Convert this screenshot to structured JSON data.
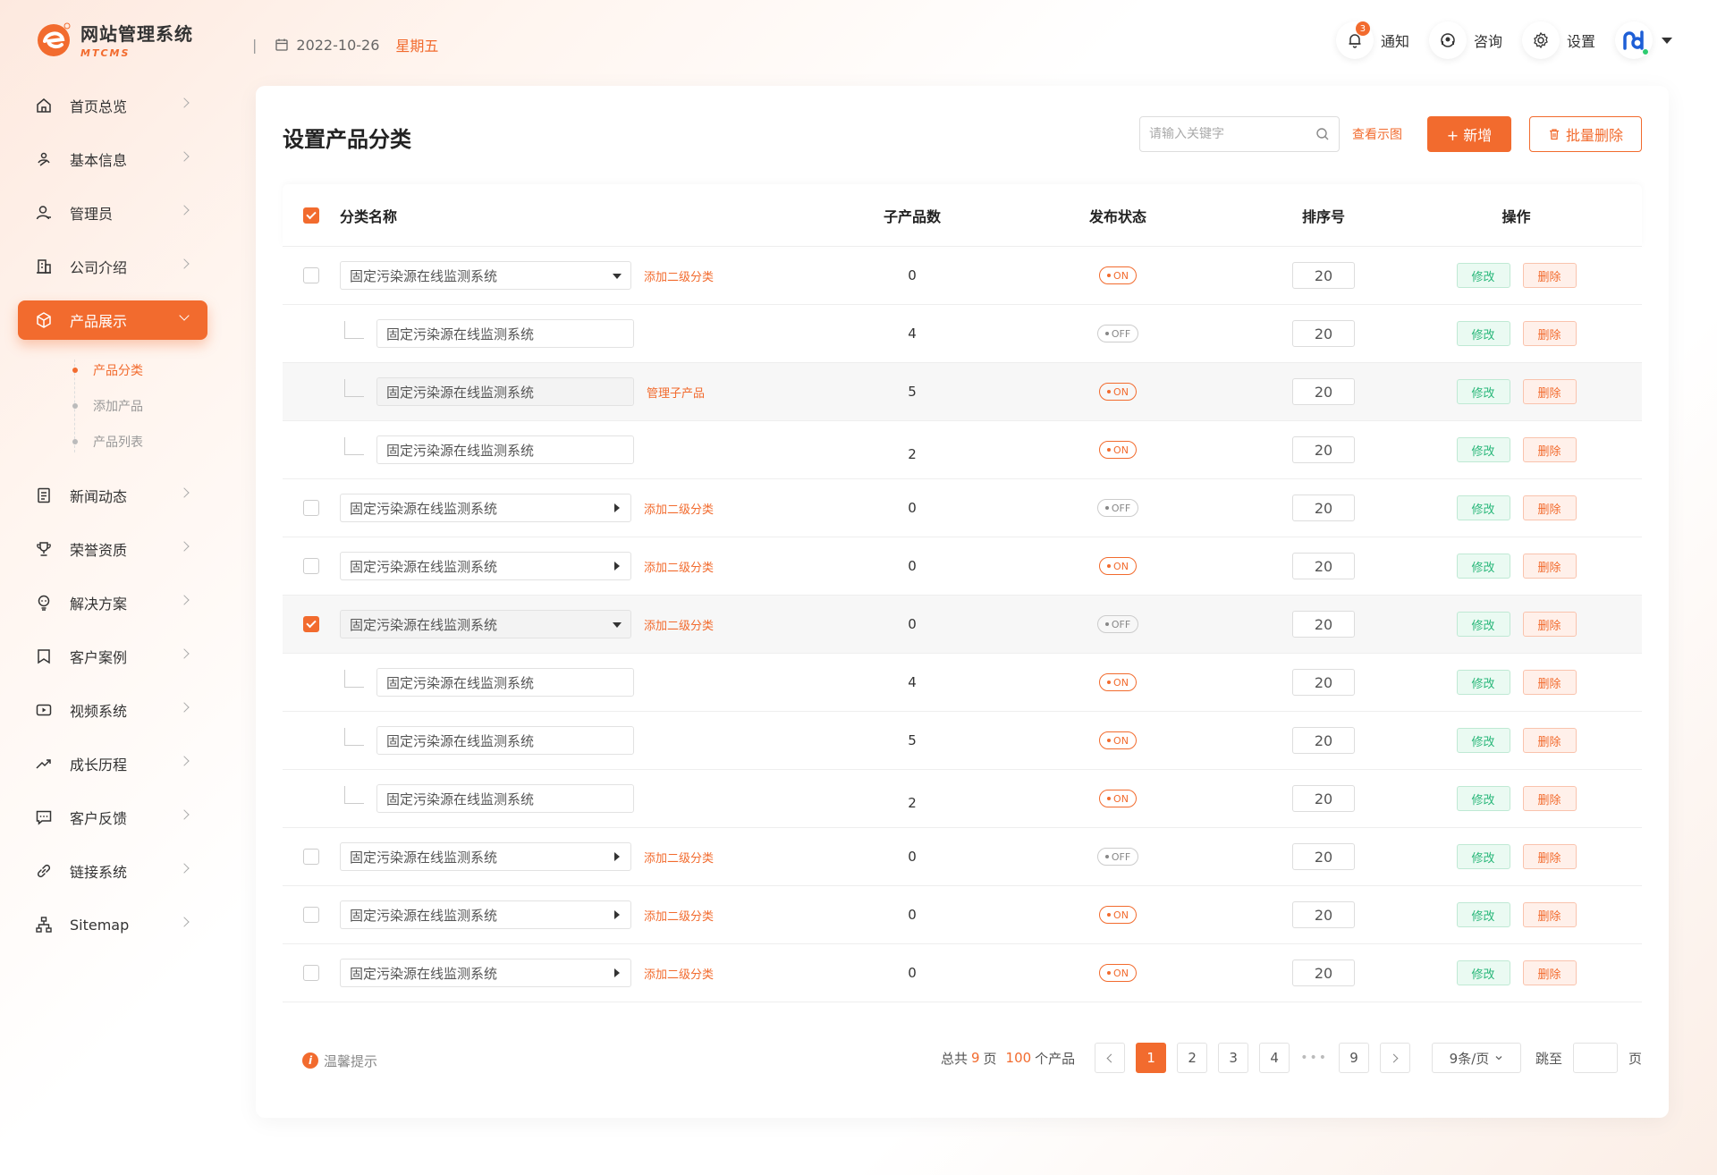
{
  "brand": {
    "title": "网站管理系统",
    "subtitle": "MTCMS"
  },
  "datebar": {
    "separator": "|",
    "date": "2022-10-26",
    "weekday": "星期五"
  },
  "topnav": {
    "notify": {
      "label": "通知",
      "badge": "3"
    },
    "consult": {
      "label": "咨询"
    },
    "settings": {
      "label": "设置"
    }
  },
  "sidebar": {
    "items": [
      {
        "label": "首页总览",
        "icon": "home-icon"
      },
      {
        "label": "基本信息",
        "icon": "info-icon"
      },
      {
        "label": "管理员",
        "icon": "user-icon"
      },
      {
        "label": "公司介绍",
        "icon": "building-icon"
      },
      {
        "label": "产品展示",
        "icon": "box-icon",
        "active": true
      },
      {
        "label": "新闻动态",
        "icon": "news-icon"
      },
      {
        "label": "荣誉资质",
        "icon": "trophy-icon"
      },
      {
        "label": "解决方案",
        "icon": "bulb-icon"
      },
      {
        "label": "客户案例",
        "icon": "bookmark-icon"
      },
      {
        "label": "视频系统",
        "icon": "video-icon"
      },
      {
        "label": "成长历程",
        "icon": "trend-icon"
      },
      {
        "label": "客户反馈",
        "icon": "chat-icon"
      },
      {
        "label": "链接系统",
        "icon": "link-icon"
      },
      {
        "label": "Sitemap",
        "icon": "sitemap-icon"
      }
    ],
    "subitems": [
      {
        "label": "产品分类",
        "active": true
      },
      {
        "label": "添加产品"
      },
      {
        "label": "产品列表"
      }
    ]
  },
  "page": {
    "title": "设置产品分类",
    "search_placeholder": "请输入关键字",
    "view_demo": "查看示图",
    "add_label": "+ 新增",
    "batch_delete_label": "批量删除"
  },
  "table": {
    "headers": {
      "name": "分类名称",
      "children": "子产品数",
      "status": "发布状态",
      "sort": "排序号",
      "ops": "操作"
    },
    "edit_label": "修改",
    "delete_label": "删除",
    "rows": [
      {
        "level": 1,
        "checked": false,
        "name": "固定污染源在线监测系统",
        "expand": "down",
        "link": "添加二级分类",
        "count": "0",
        "status": "ON",
        "sort": "20",
        "hl": false
      },
      {
        "level": 2,
        "name": "固定污染源在线监测系统",
        "link": "",
        "count": "4",
        "status": "OFF",
        "sort": "20",
        "hl": false
      },
      {
        "level": 2,
        "name": "固定污染源在线监测系统",
        "link": "管理子产品",
        "count": "5",
        "status": "ON",
        "sort": "20",
        "hl": true
      },
      {
        "level": 2,
        "name": "固定污染源在线监测系统",
        "link": "",
        "count": "2",
        "status": "ON",
        "sort": "20",
        "hl": false
      },
      {
        "level": 1,
        "checked": false,
        "name": "固定污染源在线监测系统",
        "expand": "right",
        "link": "添加二级分类",
        "count": "0",
        "status": "OFF",
        "sort": "20",
        "hl": false
      },
      {
        "level": 1,
        "checked": false,
        "name": "固定污染源在线监测系统",
        "expand": "right",
        "link": "添加二级分类",
        "count": "0",
        "status": "ON",
        "sort": "20",
        "hl": false
      },
      {
        "level": 1,
        "checked": true,
        "name": "固定污染源在线监测系统",
        "expand": "down",
        "link": "添加二级分类",
        "count": "0",
        "status": "OFF",
        "sort": "20",
        "hl": true
      },
      {
        "level": 2,
        "name": "固定污染源在线监测系统",
        "link": "",
        "count": "4",
        "status": "ON",
        "sort": "20",
        "hl": false
      },
      {
        "level": 2,
        "name": "固定污染源在线监测系统",
        "link": "",
        "count": "5",
        "status": "ON",
        "sort": "20",
        "hl": false
      },
      {
        "level": 2,
        "name": "固定污染源在线监测系统",
        "link": "",
        "count": "2",
        "status": "ON",
        "sort": "20",
        "hl": false
      },
      {
        "level": 1,
        "checked": false,
        "name": "固定污染源在线监测系统",
        "expand": "right",
        "link": "添加二级分类",
        "count": "0",
        "status": "OFF",
        "sort": "20",
        "hl": false
      },
      {
        "level": 1,
        "checked": false,
        "name": "固定污染源在线监测系统",
        "expand": "right",
        "link": "添加二级分类",
        "count": "0",
        "status": "ON",
        "sort": "20",
        "hl": false
      },
      {
        "level": 1,
        "checked": false,
        "name": "固定污染源在线监测系统",
        "expand": "right",
        "link": "添加二级分类",
        "count": "0",
        "status": "ON",
        "sort": "20",
        "hl": false
      }
    ]
  },
  "footer": {
    "tip": "温馨提示",
    "total_prefix": "总共",
    "total_pages": "9",
    "pages_unit": "页",
    "total_items": "100",
    "items_unit": "个产品",
    "pages": [
      "1",
      "2",
      "3",
      "4",
      "9"
    ],
    "current_page": "1",
    "ellipsis": "•••",
    "page_size": "9条/页",
    "jump_label": "跳至",
    "jump_unit": "页"
  },
  "colors": {
    "accent": "#f26b2e",
    "success": "#28b779"
  }
}
